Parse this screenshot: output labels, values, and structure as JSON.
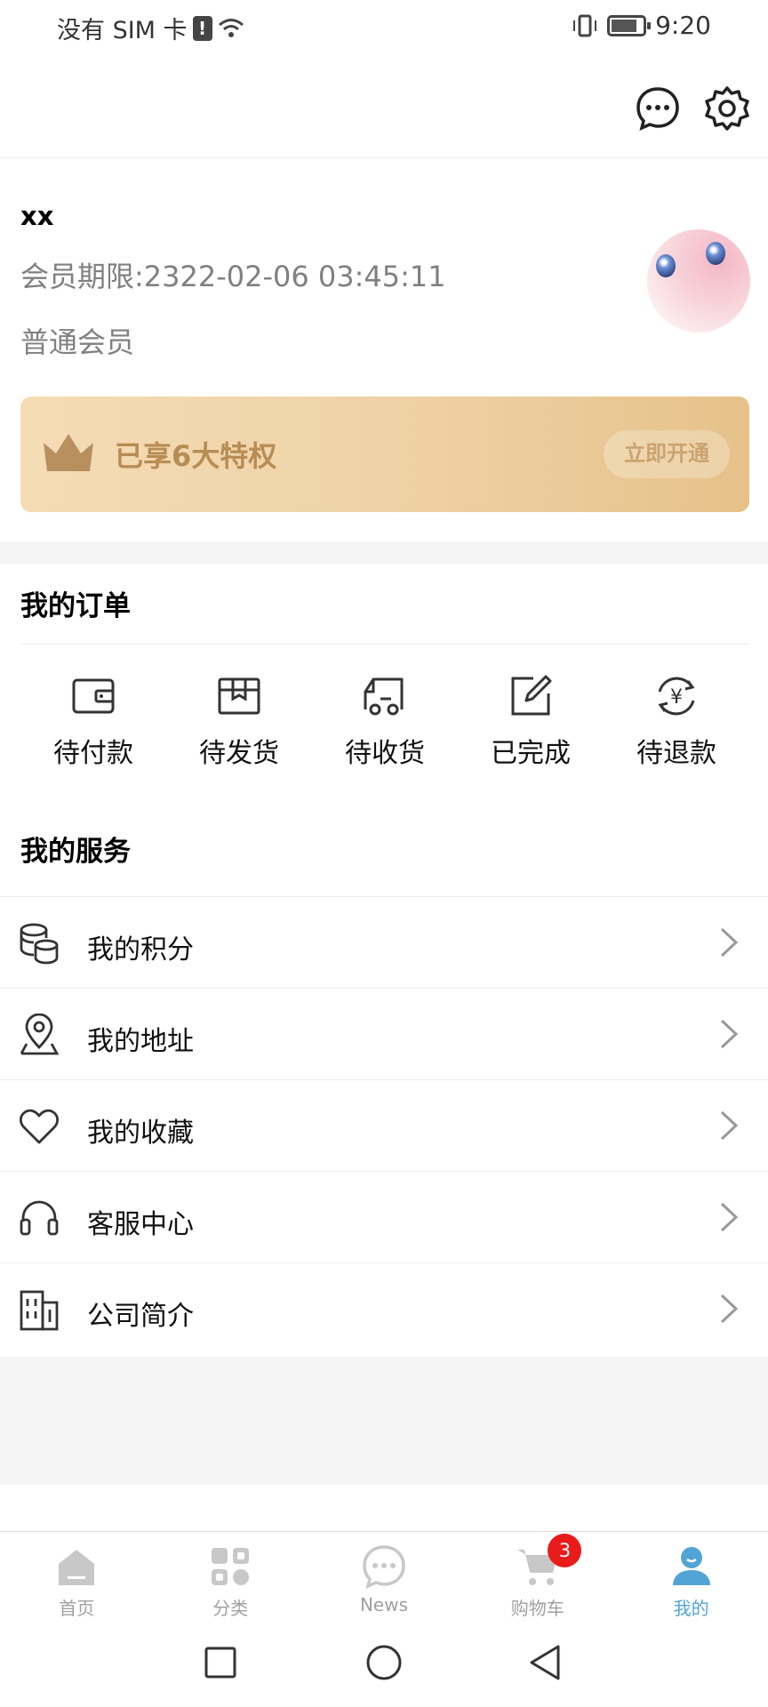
{
  "status_bar": {
    "carrier": "没有 SIM 卡",
    "time": "9:20"
  },
  "profile": {
    "username": "xx",
    "expiry": "会员期限:2322-02-06 03:45:11",
    "level": "普通会员"
  },
  "vip_card": {
    "text": "已享6大特权",
    "button": "立即开通"
  },
  "orders": {
    "title": "我的订单",
    "items": [
      {
        "label": "待付款",
        "icon": "wallet-icon"
      },
      {
        "label": "待发货",
        "icon": "box-icon"
      },
      {
        "label": "待收货",
        "icon": "truck-icon"
      },
      {
        "label": "已完成",
        "icon": "edit-check-icon"
      },
      {
        "label": "待退款",
        "icon": "refund-yen-icon"
      }
    ]
  },
  "services": {
    "title": "我的服务",
    "items": [
      {
        "label": "我的积分",
        "icon": "coins-icon"
      },
      {
        "label": "我的地址",
        "icon": "location-pin-icon"
      },
      {
        "label": "我的收藏",
        "icon": "heart-icon"
      },
      {
        "label": "客服中心",
        "icon": "headset-icon"
      },
      {
        "label": "公司简介",
        "icon": "building-icon"
      }
    ]
  },
  "bottom_nav": {
    "items": [
      {
        "label": "首页",
        "icon": "home-icon"
      },
      {
        "label": "分类",
        "icon": "category-grid-icon"
      },
      {
        "label": "News",
        "icon": "chat-bubble-icon"
      },
      {
        "label": "购物车",
        "icon": "cart-icon",
        "badge": "3"
      },
      {
        "label": "我的",
        "icon": "user-icon",
        "active": true
      }
    ]
  },
  "colors": {
    "accent": "#53a4d6",
    "vip_text": "#b78d55",
    "badge": "#ea1b1b",
    "secondary_text": "#808080"
  }
}
